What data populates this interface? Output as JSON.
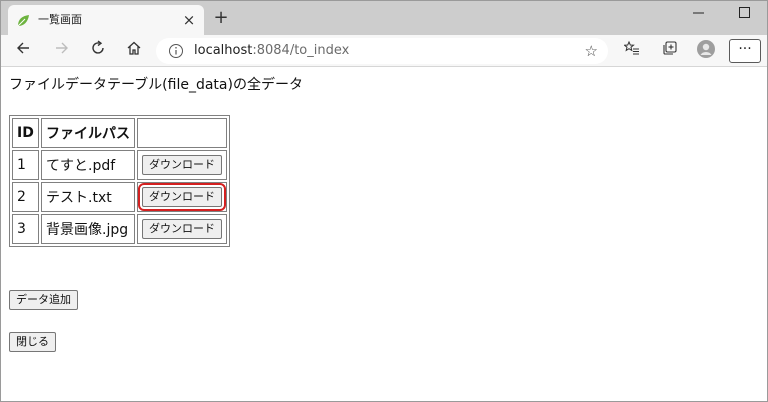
{
  "browser": {
    "tab_title": "一覧画面",
    "url_host": "localhost",
    "url_path": ":8084/to_index"
  },
  "page": {
    "heading": "ファイルデータテーブル(file_data)の全データ",
    "table": {
      "headers": [
        "ID",
        "ファイルパス",
        ""
      ],
      "rows": [
        {
          "id": "1",
          "path": "てすと.pdf",
          "action": "ダウンロード"
        },
        {
          "id": "2",
          "path": "テスト.txt",
          "action": "ダウンロード"
        },
        {
          "id": "3",
          "path": "背景画像.jpg",
          "action": "ダウンロード"
        }
      ]
    },
    "add_button": "データ追加",
    "close_button": "閉じる"
  },
  "colors": {
    "highlight": "#d42020",
    "tabstrip": "#cdcdcd",
    "favicon": "#6db33f"
  },
  "icons": [
    "leaf-favicon-icon",
    "close-icon",
    "plus-icon",
    "minimize-icon",
    "maximize-icon",
    "close-window-icon",
    "back-arrow-icon",
    "forward-arrow-icon",
    "refresh-icon",
    "home-icon",
    "info-icon",
    "star-icon",
    "favorites-icon",
    "collections-icon",
    "profile-avatar-icon",
    "more-icon"
  ]
}
